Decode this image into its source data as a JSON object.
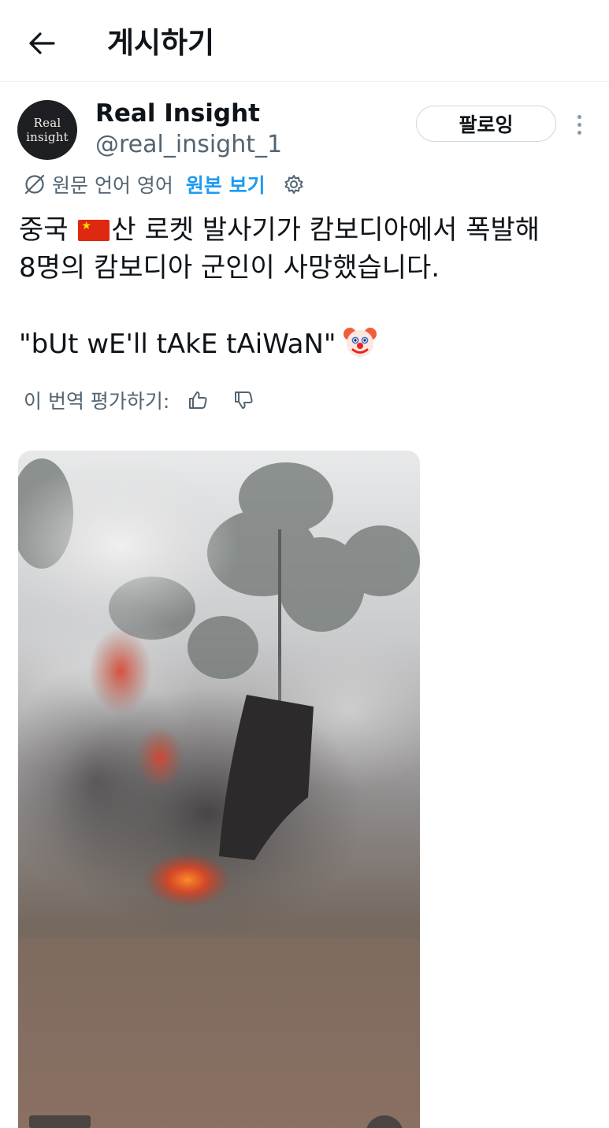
{
  "header": {
    "title": "게시하기",
    "back_icon": "arrow-left-icon"
  },
  "author": {
    "avatar_text": [
      "Real",
      "insight"
    ],
    "name": "Real Insight",
    "handle": "@real_insight_1",
    "follow_label": "팔로잉",
    "more_icon": "vertical-dots-icon"
  },
  "translation": {
    "label": "원문 언어 영어",
    "show_original": "원본 보기",
    "icons": [
      "globe-slash-icon",
      "gear-icon"
    ]
  },
  "tweet": {
    "line1_a": "중국 ",
    "line1_b": "산 로켓 발사기가 캄보디아에서 폭발해",
    "line2": "8명의 캄보디아 군인이 사망했습니다.",
    "quote": "\"bUt wE'll tAkE tAiWaN\"",
    "emojis": [
      "china-flag-icon",
      "clown-face-icon"
    ]
  },
  "rate_translation": {
    "label": "이 번역 평가하기:",
    "icons": [
      "thumbs-up-icon",
      "thumbs-down-icon"
    ]
  },
  "media": {
    "type": "video-thumbnail",
    "description_icon": "smoke-explosion-image"
  },
  "colors": {
    "accent": "#1d9bf0",
    "secondary_text": "#536471",
    "primary_text": "#0f1419",
    "border": "#cfd9de"
  }
}
